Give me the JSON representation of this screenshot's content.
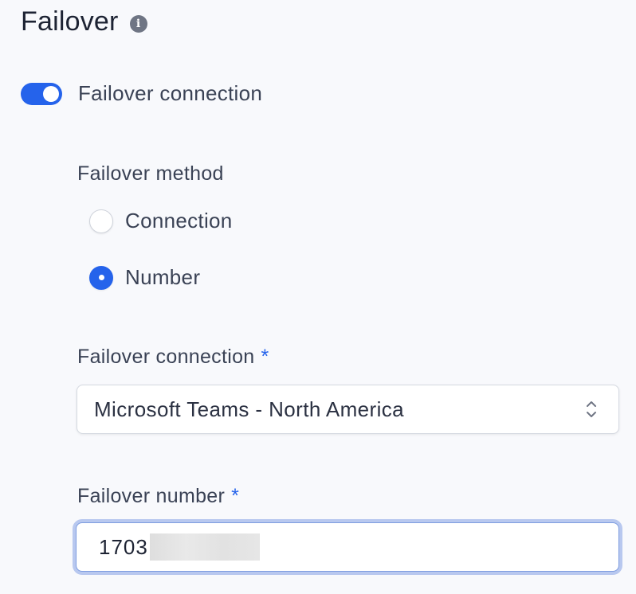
{
  "section": {
    "title": "Failover",
    "info_icon": "info-icon"
  },
  "toggle": {
    "label": "Failover connection",
    "checked": true,
    "color": "#2563eb"
  },
  "method": {
    "label": "Failover method",
    "options": [
      {
        "label": "Connection",
        "checked": false
      },
      {
        "label": "Number",
        "checked": true
      }
    ]
  },
  "connection": {
    "label": "Failover connection",
    "required_mark": "*",
    "value": "Microsoft Teams - North America",
    "chevron_icon": "chevron-up-down-icon"
  },
  "number": {
    "label": "Failover number",
    "required_mark": "*",
    "value": "1703",
    "redacted": true
  }
}
